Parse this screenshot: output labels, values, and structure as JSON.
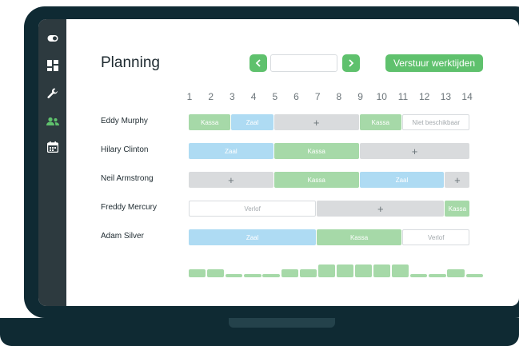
{
  "sidebar": {
    "items": [
      {
        "icon": "toggle-icon",
        "active": false
      },
      {
        "icon": "dashboard-icon",
        "active": false
      },
      {
        "icon": "wrench-icon",
        "active": false
      },
      {
        "icon": "users-icon",
        "active": true
      },
      {
        "icon": "calendar-icon",
        "active": false
      }
    ],
    "active_color": "#5fc16d"
  },
  "header": {
    "title": "Planning",
    "prev_label": "‹",
    "next_label": "›",
    "date_value": "",
    "send_label": "Verstuur werktijden"
  },
  "hours": [
    "1",
    "2",
    "3",
    "4",
    "5",
    "6",
    "7",
    "8",
    "9",
    "10",
    "11",
    "12",
    "13",
    "14"
  ],
  "rows": [
    {
      "name": "Eddy Murphy",
      "shifts": [
        {
          "type": "kassa",
          "label": "Kassa",
          "start": 1,
          "end": 3
        },
        {
          "type": "zaal",
          "label": "Zaal",
          "start": 3,
          "end": 5
        },
        {
          "type": "plus",
          "label": "+",
          "start": 5,
          "end": 9
        },
        {
          "type": "kassa",
          "label": "Kassa",
          "start": 9,
          "end": 11
        },
        {
          "type": "nb",
          "label": "Niet beschikbaar",
          "start": 11,
          "end": 14.2
        }
      ]
    },
    {
      "name": "Hilary Clinton",
      "shifts": [
        {
          "type": "zaal",
          "label": "Zaal",
          "start": 1,
          "end": 5
        },
        {
          "type": "kassa",
          "label": "Kassa",
          "start": 5,
          "end": 9
        },
        {
          "type": "plus",
          "label": "+",
          "start": 9,
          "end": 14.2
        }
      ]
    },
    {
      "name": "Neil Armstrong",
      "shifts": [
        {
          "type": "plus",
          "label": "+",
          "start": 1,
          "end": 5
        },
        {
          "type": "kassa",
          "label": "Kassa",
          "start": 5,
          "end": 9
        },
        {
          "type": "zaal",
          "label": "Zaal",
          "start": 9,
          "end": 13
        },
        {
          "type": "plus",
          "label": "+",
          "start": 13,
          "end": 14.2
        }
      ]
    },
    {
      "name": "Freddy Mercury",
      "shifts": [
        {
          "type": "verlof",
          "label": "Verlof",
          "start": 1,
          "end": 7
        },
        {
          "type": "plus",
          "label": "+",
          "start": 7,
          "end": 13
        },
        {
          "type": "kassa",
          "label": "Kassa",
          "start": 13,
          "end": 14.2
        }
      ]
    },
    {
      "name": "Adam Silver",
      "shifts": [
        {
          "type": "zaal",
          "label": "Zaal",
          "start": 1,
          "end": 7
        },
        {
          "type": "kassa",
          "label": "Kassa",
          "start": 7,
          "end": 11
        },
        {
          "type": "verlof",
          "label": "Verlof",
          "start": 11,
          "end": 14.2
        }
      ]
    }
  ],
  "staffing_levels": [
    2,
    2,
    1,
    1,
    1,
    2,
    2,
    3,
    3,
    3,
    3,
    3,
    1,
    1,
    2,
    1
  ]
}
